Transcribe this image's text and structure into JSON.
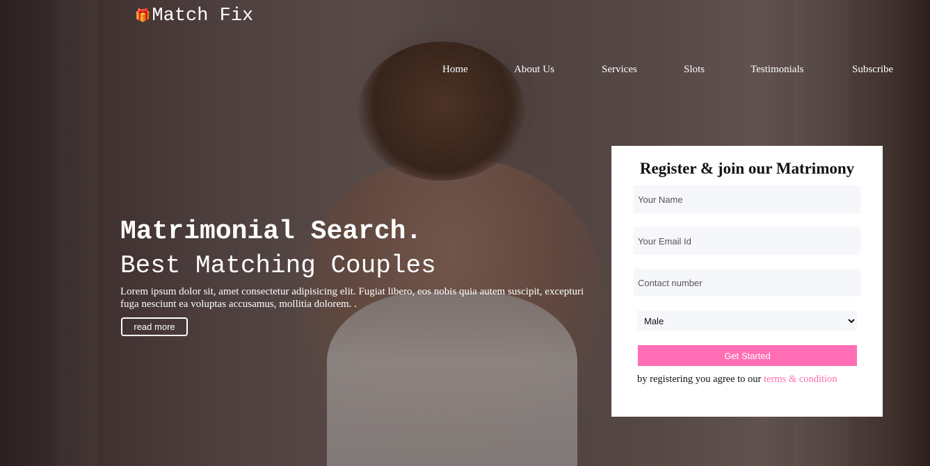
{
  "brand": {
    "name": "Match Fix",
    "icon": "gift-icon",
    "accent": "#ff6eb4"
  },
  "nav": {
    "items": [
      {
        "label": "Home"
      },
      {
        "label": "About Us"
      },
      {
        "label": "Services"
      },
      {
        "label": "Slots"
      },
      {
        "label": "Testimonials"
      },
      {
        "label": "Subscribe"
      }
    ]
  },
  "hero": {
    "title": "Matrimonial Search.",
    "subtitle": "Best Matching Couples",
    "text": "Lorem ipsum dolor sit, amet consectetur adipisicing elit. Fugiat libero, eos nobis quia autem suscipit, excepturi fuga nesciunt ea voluptas accusamus, mollitia dolorem. .",
    "button_label": "read more"
  },
  "form": {
    "title": "Register & join our Matrimony",
    "name_placeholder": "Your Name",
    "email_placeholder": "Your Email Id",
    "phone_placeholder": "Contact number",
    "gender_selected": "Male",
    "submit_label": "Get Started",
    "terms_prefix": "by registering you agree to our",
    "terms_link": "terms & condition"
  }
}
